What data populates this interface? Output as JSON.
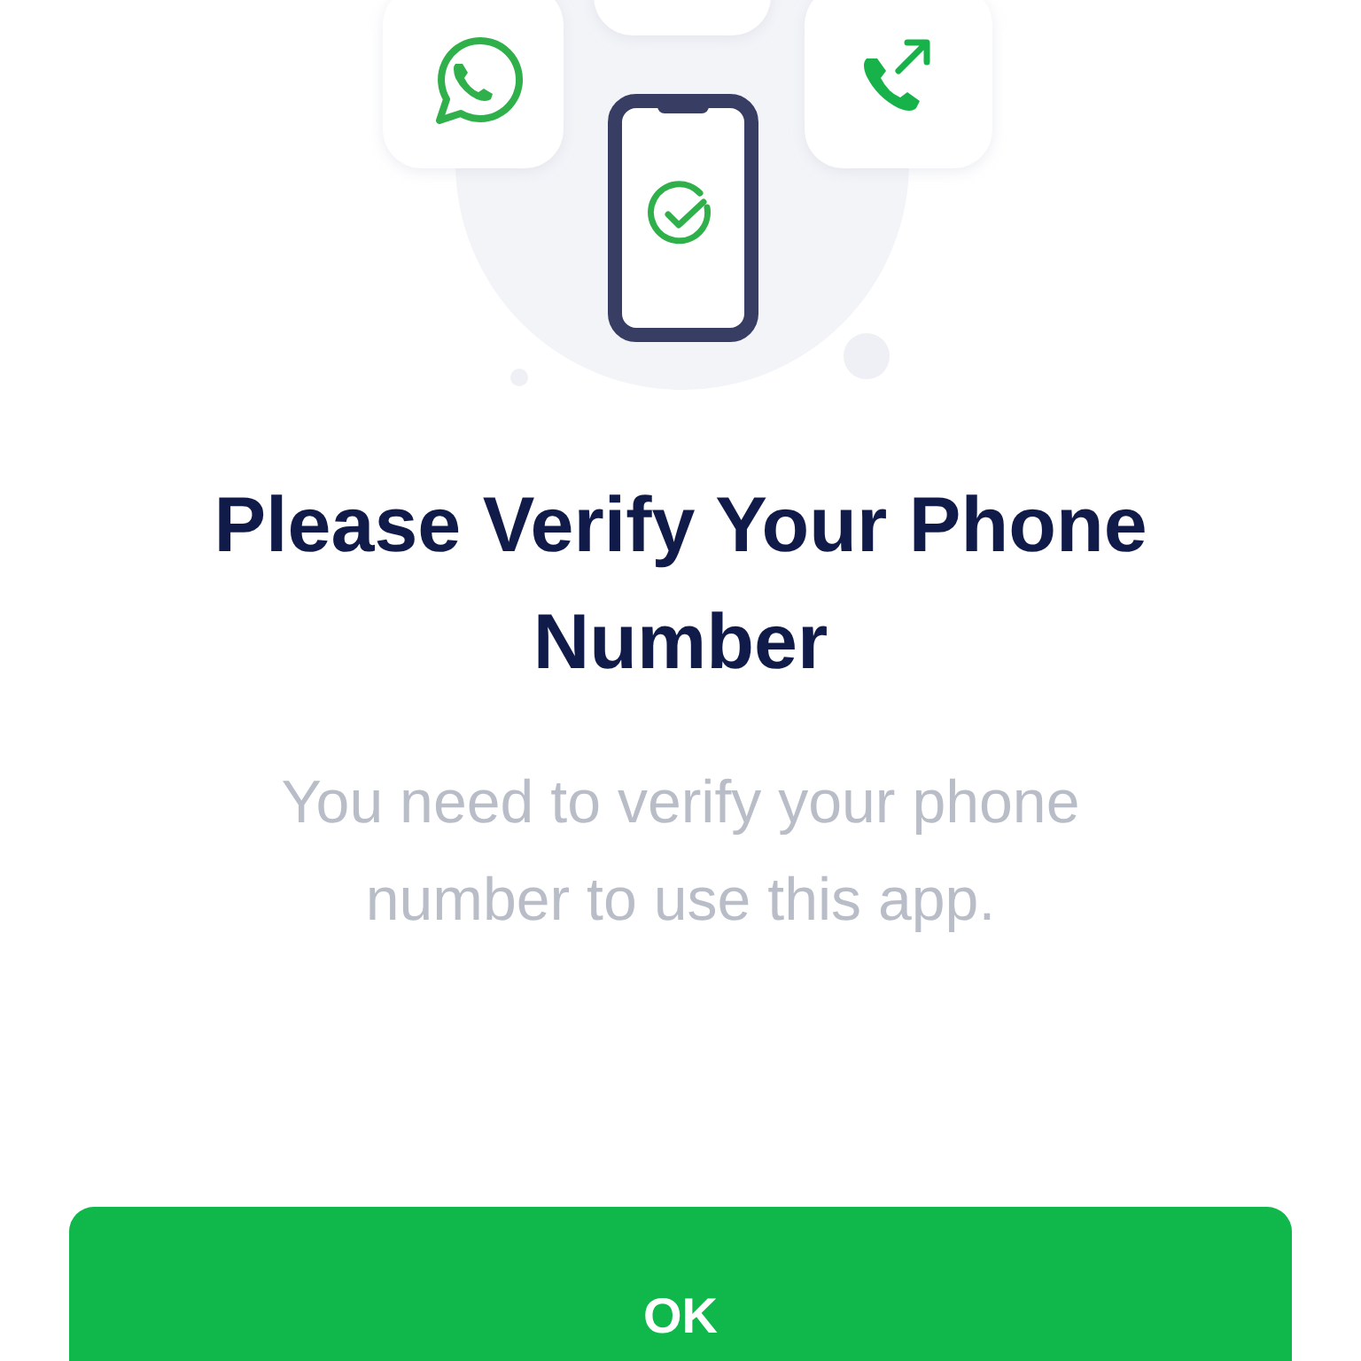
{
  "title": "Please Verify Your Phone Number",
  "message": "You need to verify your phone number to use this app.",
  "button": {
    "label": "OK"
  }
}
